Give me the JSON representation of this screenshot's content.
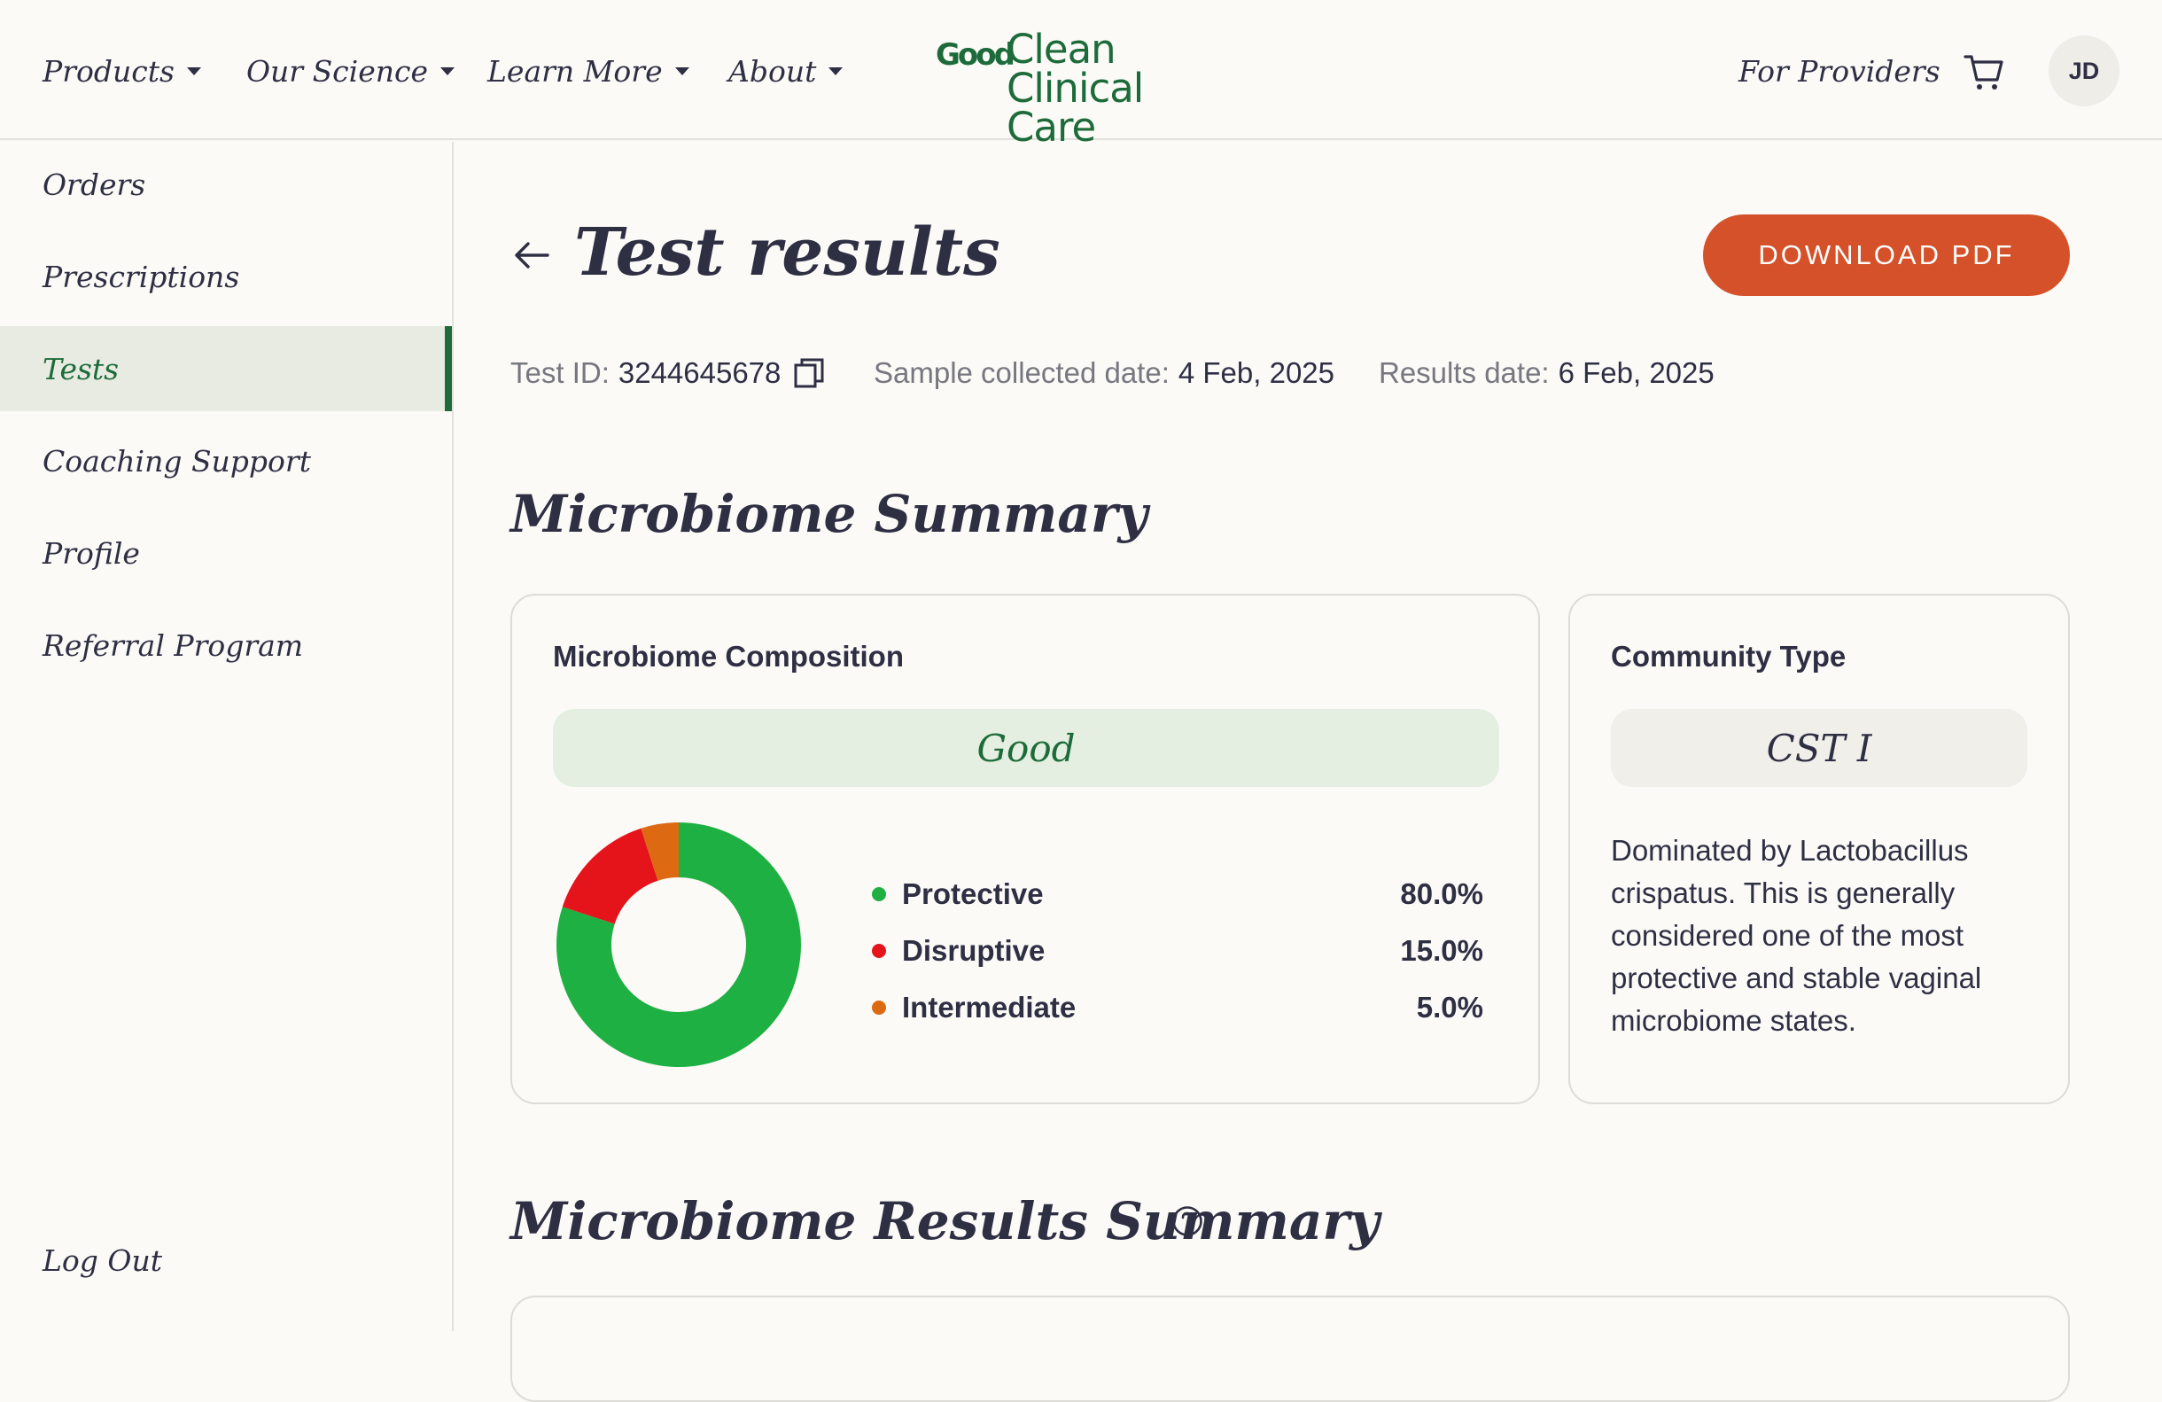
{
  "nav": {
    "items": [
      {
        "label": "Products"
      },
      {
        "label": "Our Science"
      },
      {
        "label": "Learn More"
      },
      {
        "label": "About"
      }
    ],
    "logo": {
      "good": "Good",
      "line1": "Clean",
      "line2": "Clinical Care"
    },
    "providers_label": "For Providers",
    "cart_icon": "cart-icon",
    "avatar_initials": "JD"
  },
  "sidebar": {
    "items": [
      {
        "label": "Orders"
      },
      {
        "label": "Prescriptions"
      },
      {
        "label": "Tests",
        "active": true
      },
      {
        "label": "Coaching Support"
      },
      {
        "label": "Profile"
      },
      {
        "label": "Referral Program"
      }
    ],
    "logout_label": "Log Out"
  },
  "page": {
    "title": "Test results",
    "download_label": "DOWNLOAD PDF",
    "test_id_label": "Test ID:",
    "test_id": "3244645678",
    "sample_label": "Sample collected date:",
    "sample_date": "4 Feb, 2025",
    "results_label": "Results date:",
    "results_date": "6 Feb, 2025"
  },
  "summary": {
    "title": "Microbiome Summary",
    "composition": {
      "title": "Microbiome Composition",
      "status": "Good",
      "items": [
        {
          "label": "Protective",
          "value": "80.0%",
          "pct": 80,
          "color": "#1fb043"
        },
        {
          "label": "Disruptive",
          "value": "15.0%",
          "pct": 15,
          "color": "#e5131a"
        },
        {
          "label": "Intermediate",
          "value": "5.0%",
          "pct": 5,
          "color": "#dd6a13"
        }
      ]
    },
    "community": {
      "title": "Community Type",
      "type": "CST I",
      "description": "Dominated by Lactobacillus crispatus. This is generally considered one of the most protective and stable vaginal microbiome states."
    }
  },
  "results_summary": {
    "title": "Microbiome Results Summary"
  },
  "colors": {
    "brand_green": "#1d6b3a",
    "accent_orange": "#d4512a",
    "background": "#fbfaf7"
  }
}
